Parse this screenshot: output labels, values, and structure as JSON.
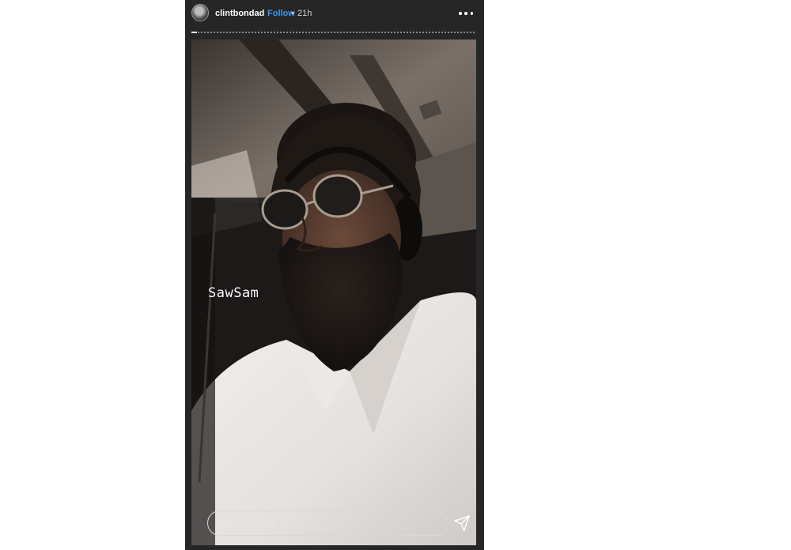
{
  "story": {
    "username": "clintbondad",
    "follow_label": "Follow",
    "separator": "•",
    "time": "21h",
    "progress": 0.02,
    "caption": "SawSam",
    "reply_placeholder": "Send Message"
  },
  "icons": {
    "more": "more-options-icon",
    "send": "paper-plane-icon"
  },
  "colors": {
    "follow": "#3897f0",
    "story_bg": "#262626",
    "text": "#ffffff"
  }
}
